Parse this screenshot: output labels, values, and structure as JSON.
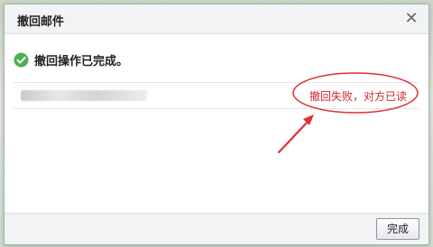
{
  "dialog": {
    "title": "撤回邮件",
    "close_icon": "close-icon"
  },
  "status": {
    "icon": "check-circle-icon",
    "icon_color": "#4caf50",
    "message": "撤回操作已完成。"
  },
  "results": [
    {
      "recipient": "",
      "status_text": "撤回失败，对方已读",
      "status_color": "#d0252b"
    }
  ],
  "annotation": {
    "color": "#e03030",
    "shapes": [
      "ellipse-highlight",
      "arrow"
    ]
  },
  "footer": {
    "done_label": "完成"
  }
}
